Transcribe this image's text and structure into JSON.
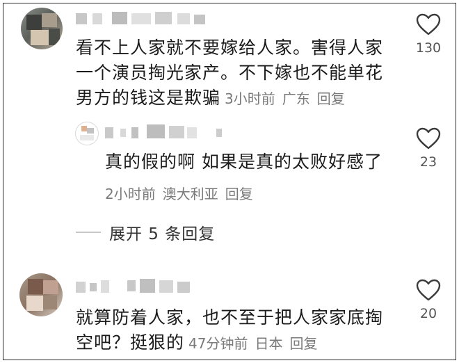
{
  "comments": [
    {
      "text_lines": [
        "看不上人家就不要嫁给人家。害得人家",
        "一个演员掏光家产。不下嫁也不能单花",
        "男方的钱这是欺骗"
      ],
      "time": "3小时前",
      "location": "广东",
      "reply_label": "回复",
      "likes": "130",
      "icon": "heart-outline-icon"
    },
    {
      "text_lines": [
        "真的假的啊 如果是真的太败好感了"
      ],
      "time": "2小时前",
      "location": "澳大利亚",
      "reply_label": "回复",
      "likes": "23",
      "icon": "heart-outline-icon"
    },
    {
      "text_lines": [
        "就算防着人家，也不至于把人家家底掏",
        "空吧？挺狠的"
      ],
      "time": "47分钟前",
      "location": "日本",
      "reply_label": "回复",
      "likes": "20",
      "icon": "heart-outline-icon"
    }
  ],
  "expand_replies": "展开 5 条回复"
}
